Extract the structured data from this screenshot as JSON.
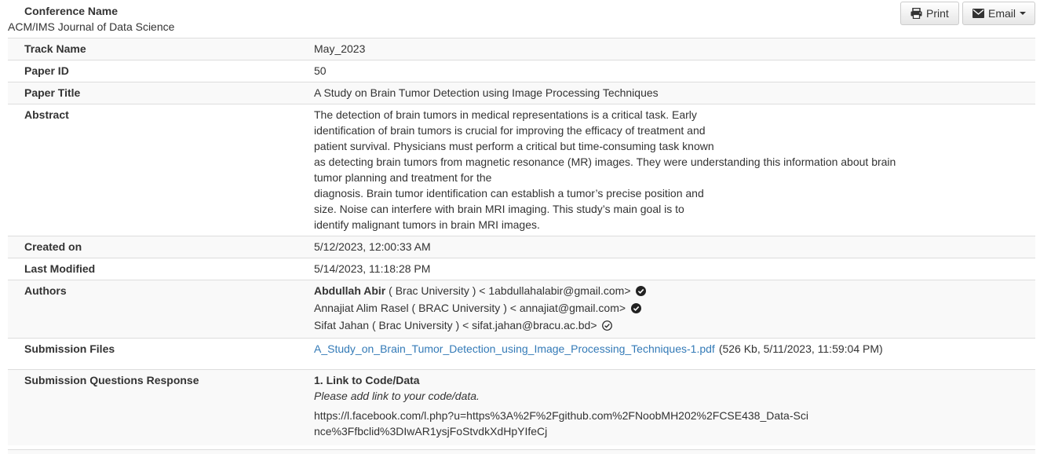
{
  "conference": {
    "label": "Conference Name",
    "value": "ACM/IMS Journal of Data Science"
  },
  "toolbar": {
    "print_label": "Print",
    "email_label": "Email"
  },
  "rows": {
    "track": {
      "label": "Track Name",
      "value": "May_2023"
    },
    "paper_id": {
      "label": "Paper ID",
      "value": "50"
    },
    "paper_title": {
      "label": "Paper Title",
      "value": "A Study on Brain Tumor Detection using Image Processing Techniques"
    },
    "abstract": {
      "label": "Abstract",
      "lines": [
        "The detection of brain tumors in medical representations is a critical task. Early",
        "identification of brain tumors is crucial for improving the efficacy of treatment and",
        "patient survival. Physicians must perform a critical but time-consuming task known",
        "as detecting brain tumors from magnetic resonance (MR) images. They were understanding this information about brain tumor planning and treatment for the",
        "diagnosis. Brain tumor identification can establish a tumor’s precise position and",
        "size. Noise can interfere with brain MRI imaging. This study’s main goal is to",
        "identify malignant tumors in brain MRI images."
      ]
    },
    "created_on": {
      "label": "Created on",
      "value": "5/12/2023, 12:00:33 AM"
    },
    "last_modified": {
      "label": "Last Modified",
      "value": "5/14/2023, 11:18:28 PM"
    },
    "authors": {
      "label": "Authors",
      "items": [
        {
          "name": "Abdullah Abir",
          "details": " ( Brac University ) < 1abdullahalabir@gmail.com>",
          "verified": true
        },
        {
          "name": "Annajiat Alim Rasel",
          "details": " ( BRAC University ) < annajiat@gmail.com>",
          "verified": true
        },
        {
          "name": "Sifat Jahan",
          "details": " ( Brac University ) < sifat.jahan@bracu.ac.bd>",
          "verified": false
        }
      ]
    },
    "submission_files": {
      "label": "Submission Files",
      "file_name": "A_Study_on_Brain_Tumor_Detection_using_Image_Processing_Techniques-1.pdf",
      "file_meta": "(526 Kb, 5/11/2023, 11:59:04 PM)"
    },
    "questions": {
      "label": "Submission Questions Response",
      "title": "1. Link to Code/Data",
      "hint": "Please add link to your code/data.",
      "answer": "https://l.facebook.com/l.php?u=https%3A%2F%2Fgithub.com%2FNoobMH202%2FCSE438_Data-Scince%3Ffbclid%3DIwAR1ysjFoStvdkXdHpYIfeCj"
    }
  },
  "colors": {
    "link": "#337ab7",
    "stripe": "#f9f9f9",
    "border": "#dddddd"
  }
}
